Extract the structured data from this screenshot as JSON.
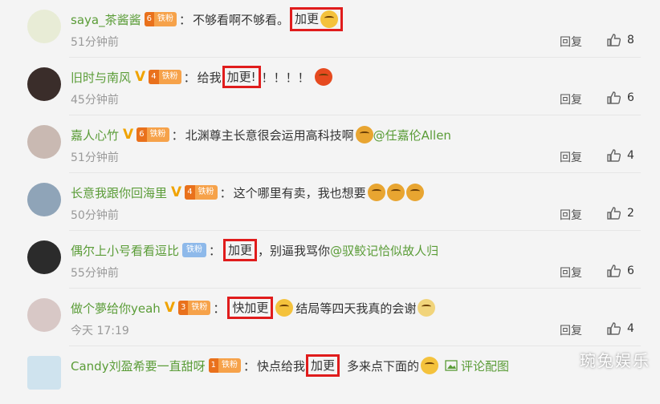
{
  "comments": [
    {
      "user": "saya_茶酱酱",
      "fan_level": "6",
      "fan_label": "铁粉",
      "before": "不够看啊不够看。",
      "highlight": "加更",
      "after": "",
      "mention": "",
      "time": "51分钟前",
      "reply": "回复",
      "likes": "8"
    },
    {
      "user": "旧时与南风",
      "fan_level": "4",
      "fan_label": "铁粉",
      "before": "给我",
      "highlight": "加更!",
      "after": "！！！！",
      "mention": "",
      "time": "45分钟前",
      "reply": "回复",
      "likes": "6"
    },
    {
      "user": "嘉人心竹",
      "fan_level": "6",
      "fan_label": "铁粉",
      "before": "北渊尊主长意很会运用高科技啊",
      "highlight": "",
      "after": "",
      "mention": "@任嘉伦Allen",
      "time": "51分钟前",
      "reply": "回复",
      "likes": "4"
    },
    {
      "user": "长意我跟你回海里",
      "fan_level": "4",
      "fan_label": "铁粉",
      "before": "这个哪里有卖，我也想要",
      "highlight": "",
      "after": "",
      "mention": "",
      "time": "50分钟前",
      "reply": "回复",
      "likes": "2"
    },
    {
      "user": "偶尔上小号看看逗比",
      "fan_level": "",
      "fan_label": "铁粉",
      "before": "",
      "highlight": "加更",
      "after": "，别逼我骂你",
      "mention": "@驭鲛记恰似故人归",
      "time": "55分钟前",
      "reply": "回复",
      "likes": "6"
    },
    {
      "user": "做个夢给你yeah",
      "fan_level": "3",
      "fan_label": "铁粉",
      "before": "",
      "highlight": "快加更",
      "after": "结局等四天我真的会谢",
      "mention": "",
      "time": "今天 17:19",
      "reply": "回复",
      "likes": "4"
    },
    {
      "user": "Candy刘盈希要一直甜呀",
      "fan_level": "1",
      "fan_label": "铁粉",
      "before": "快点给我",
      "highlight": "加更",
      "after": "多来点下面的",
      "mention": "",
      "time": "",
      "reply": "",
      "likes": "",
      "pic_link": "评论配图"
    }
  ],
  "watermark": "琬兔娱乐",
  "colors": {
    "username": "#5a9c37",
    "highlight_box": "#e01c1c",
    "fan_badge": "#f6a24a"
  }
}
